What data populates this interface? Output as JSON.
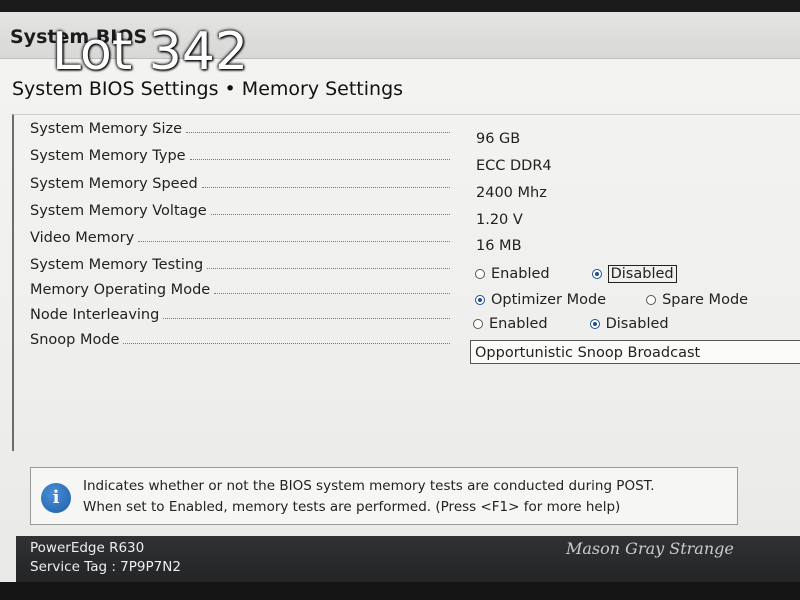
{
  "header": {
    "app_title": "System BIOS",
    "overlay_text": "Lot 342"
  },
  "page": {
    "heading": "System BIOS Settings • Memory Settings"
  },
  "settings": {
    "memory_size": {
      "label": "System Memory Size",
      "value": "96 GB"
    },
    "memory_type": {
      "label": "System Memory Type",
      "value": "ECC DDR4"
    },
    "memory_speed": {
      "label": "System Memory Speed",
      "value": "2400 Mhz"
    },
    "memory_voltage": {
      "label": "System Memory Voltage",
      "value": "1.20 V"
    },
    "video_memory": {
      "label": "Video Memory",
      "value": "16 MB"
    },
    "memory_testing": {
      "label": "System Memory Testing",
      "options": [
        "Enabled",
        "Disabled"
      ],
      "selected": "Disabled"
    },
    "operating_mode": {
      "label": "Memory Operating Mode",
      "options": [
        "Optimizer Mode",
        "Spare Mode"
      ],
      "selected": "Optimizer Mode"
    },
    "node_interleaving": {
      "label": "Node Interleaving",
      "options": [
        "Enabled",
        "Disabled"
      ],
      "selected": "Disabled"
    },
    "snoop_mode": {
      "label": "Snoop Mode",
      "value": "Opportunistic Snoop Broadcast"
    }
  },
  "help": {
    "icon": "info-icon",
    "line1": "Indicates whether or not the BIOS system memory tests are conducted during POST.",
    "line2": "When set to Enabled, memory tests are performed. (Press <F1> for more help)"
  },
  "footer": {
    "model": "PowerEdge R630",
    "service_tag": "Service Tag : 7P9P7N2",
    "watermark": "Mason Gray Strange"
  },
  "colors": {
    "radio_selected": "#1d4f91",
    "info_icon": "#1b5ea8",
    "footer_bg": "#2f3134"
  }
}
